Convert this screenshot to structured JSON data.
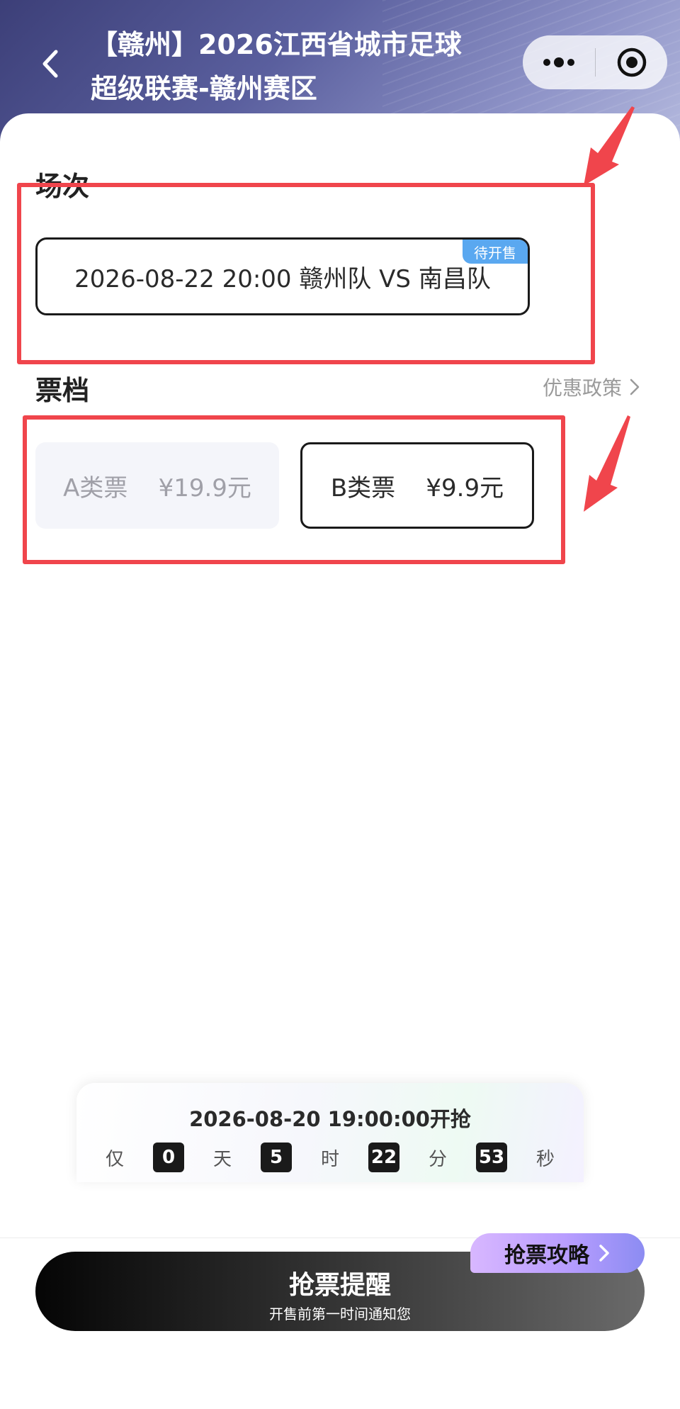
{
  "nav": {
    "title_line1": "【赣州】2026江西省城市足球",
    "title_line2": "超级联赛-赣州赛区",
    "back_icon": "chevron-left-icon",
    "more_icon": "more-dots-icon",
    "close_icon": "target-circle-icon"
  },
  "session": {
    "heading": "场次",
    "card_text": "2026-08-22 20:00 赣州队 VS 南昌队",
    "badge": "待开售"
  },
  "tickets": {
    "heading": "票档",
    "policy_link": "优惠政策",
    "items": [
      {
        "label": "A类票    ¥19.9元",
        "state": "unselected"
      },
      {
        "label": "B类票    ¥9.9元",
        "state": "selected"
      }
    ]
  },
  "countdown": {
    "title": "2026-08-20 19:00:00开抢",
    "prefix": "仅",
    "days": "0",
    "days_unit": "天",
    "hours": "5",
    "hours_unit": "时",
    "minutes": "22",
    "minutes_unit": "分",
    "seconds": "53",
    "seconds_unit": "秒"
  },
  "footer": {
    "remind_title": "抢票提醒",
    "remind_sub": "开售前第一时间通知您",
    "strategy_label": "抢票攻略"
  },
  "colors": {
    "annotation_red": "#f0454c",
    "badge_blue": "#5aa8f0",
    "header_purple": "#5a5f9e"
  }
}
